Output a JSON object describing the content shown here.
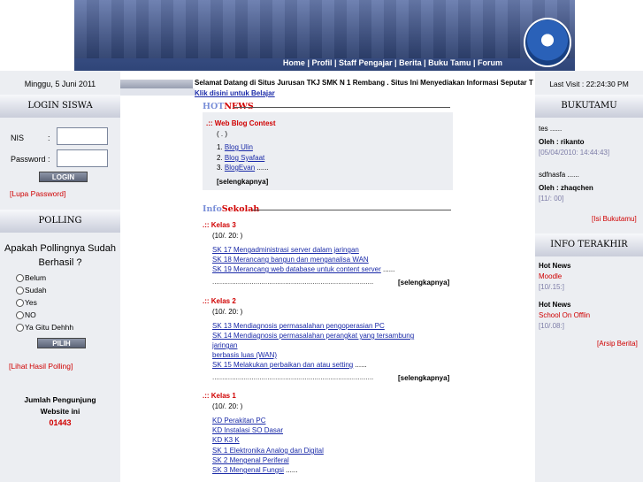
{
  "banner": {
    "nav": [
      "Home",
      "Profil",
      "Staff Pengajar",
      "Berita",
      "Buku Tamu",
      "Forum"
    ],
    "separator": " | "
  },
  "left": {
    "date": "Minggu, 5 Juni 2011",
    "login_title": "LOGIN SISWA",
    "nis_label": "NIS",
    "nis_colon": ":",
    "password_label": "Password",
    "password_colon": ":",
    "login_button": "LOGIN",
    "lupa_password": "Lupa Password",
    "polling_title": "POLLING",
    "poll_question": "Apakah Pollingnya Sudah Berhasil ?",
    "poll_options": [
      "Belum",
      "Sudah",
      "Yes",
      "NO",
      "Ya Gitu Dehhh"
    ],
    "pilih_button": "PILIH",
    "lihat_hasil": "Lihat Hasil Polling",
    "visitors_label": "Jumlah Pengunjung Website ini",
    "visitors_label_1": "Jumlah Pengunjung",
    "visitors_label_2": "Website ini",
    "visitors_count": "01443"
  },
  "center": {
    "marquee": "Selamat Datang di Situs Jurusan TKJ SMK N 1 Rembang . Situs Ini Menyediakan Informasi Seputar T",
    "belajar_link": "Klik disini untuk Belajar",
    "hotnews": {
      "a": "HOT",
      "b": "NEWS"
    },
    "blog": {
      "title": ".:: Web Blog Contest",
      "meta": "( . )",
      "items": [
        {
          "num": "1.",
          "label": "Blog Ulin"
        },
        {
          "num": "2.",
          "label": "Blog Syafaat"
        },
        {
          "num": "3.",
          "label": "BlogEvan",
          "suffix": " ......"
        }
      ],
      "more": "[selengkapnya]"
    },
    "infosekolah": {
      "a": "Info",
      "b": "Sekolah"
    },
    "kelas3": {
      "title": ".:: Kelas 3",
      "meta": "(10/. 20: )",
      "links": [
        "SK 17 Mengadministrasi server dalam jaringan",
        "SK 18 Merancang bangun dan menganalisa WAN",
        "SK 19 Merancang web database untuk content server"
      ],
      "link3_suffix": " ......",
      "dots": "..................................................................................",
      "more": "[selengkapnya]"
    },
    "kelas2": {
      "title": ".:: Kelas 2",
      "meta": "(10/. 20: )",
      "links": [
        "SK 13 Mendiagnosis permasalahan pengoperasian PC",
        "SK 14 Mendiagnosis permasalahan perangkat yang tersambung",
        "jaringan",
        "berbasis luas (WAN)",
        "SK 15 Melakukan perbaikan dan atau setting"
      ],
      "link5_suffix": " ......",
      "dots": "..................................................................................",
      "more": "[selengkapnya]"
    },
    "kelas1": {
      "title": ".:: Kelas 1",
      "meta": "(10/. 20: )",
      "links": [
        "KD Perakitan PC",
        "KD Instalasi SO Dasar",
        "KD K3 K",
        "SK 1 Elektronika Analog dan Digital",
        "SK 2 Mengenal Periferal",
        "SK 3 Mengenal Fungsi"
      ],
      "link6_suffix": " ......"
    }
  },
  "right": {
    "last_visit": "Last Visit : 22:24:30 PM",
    "bukutamu_title": "BUKUTAMU",
    "entries": [
      {
        "msg": "tes ......",
        "by": "Oleh : rikanto",
        "time": "[05/04/2010: 14:44:43]"
      },
      {
        "msg": "sdfnasfa ......",
        "by": "Oleh : zhaqchen",
        "time": "[11/: 00]"
      }
    ],
    "isi_bukutamu": "Isi Bukutamu",
    "info_title": "INFO TERAKHIR",
    "news": [
      {
        "label": "Hot News",
        "title": "Moodle",
        "time": "[10/.15:]"
      },
      {
        "label": "Hot News",
        "title": "School On Offlin",
        "time": "[10/.08:]"
      }
    ],
    "arsip": "Arsip Berita"
  }
}
